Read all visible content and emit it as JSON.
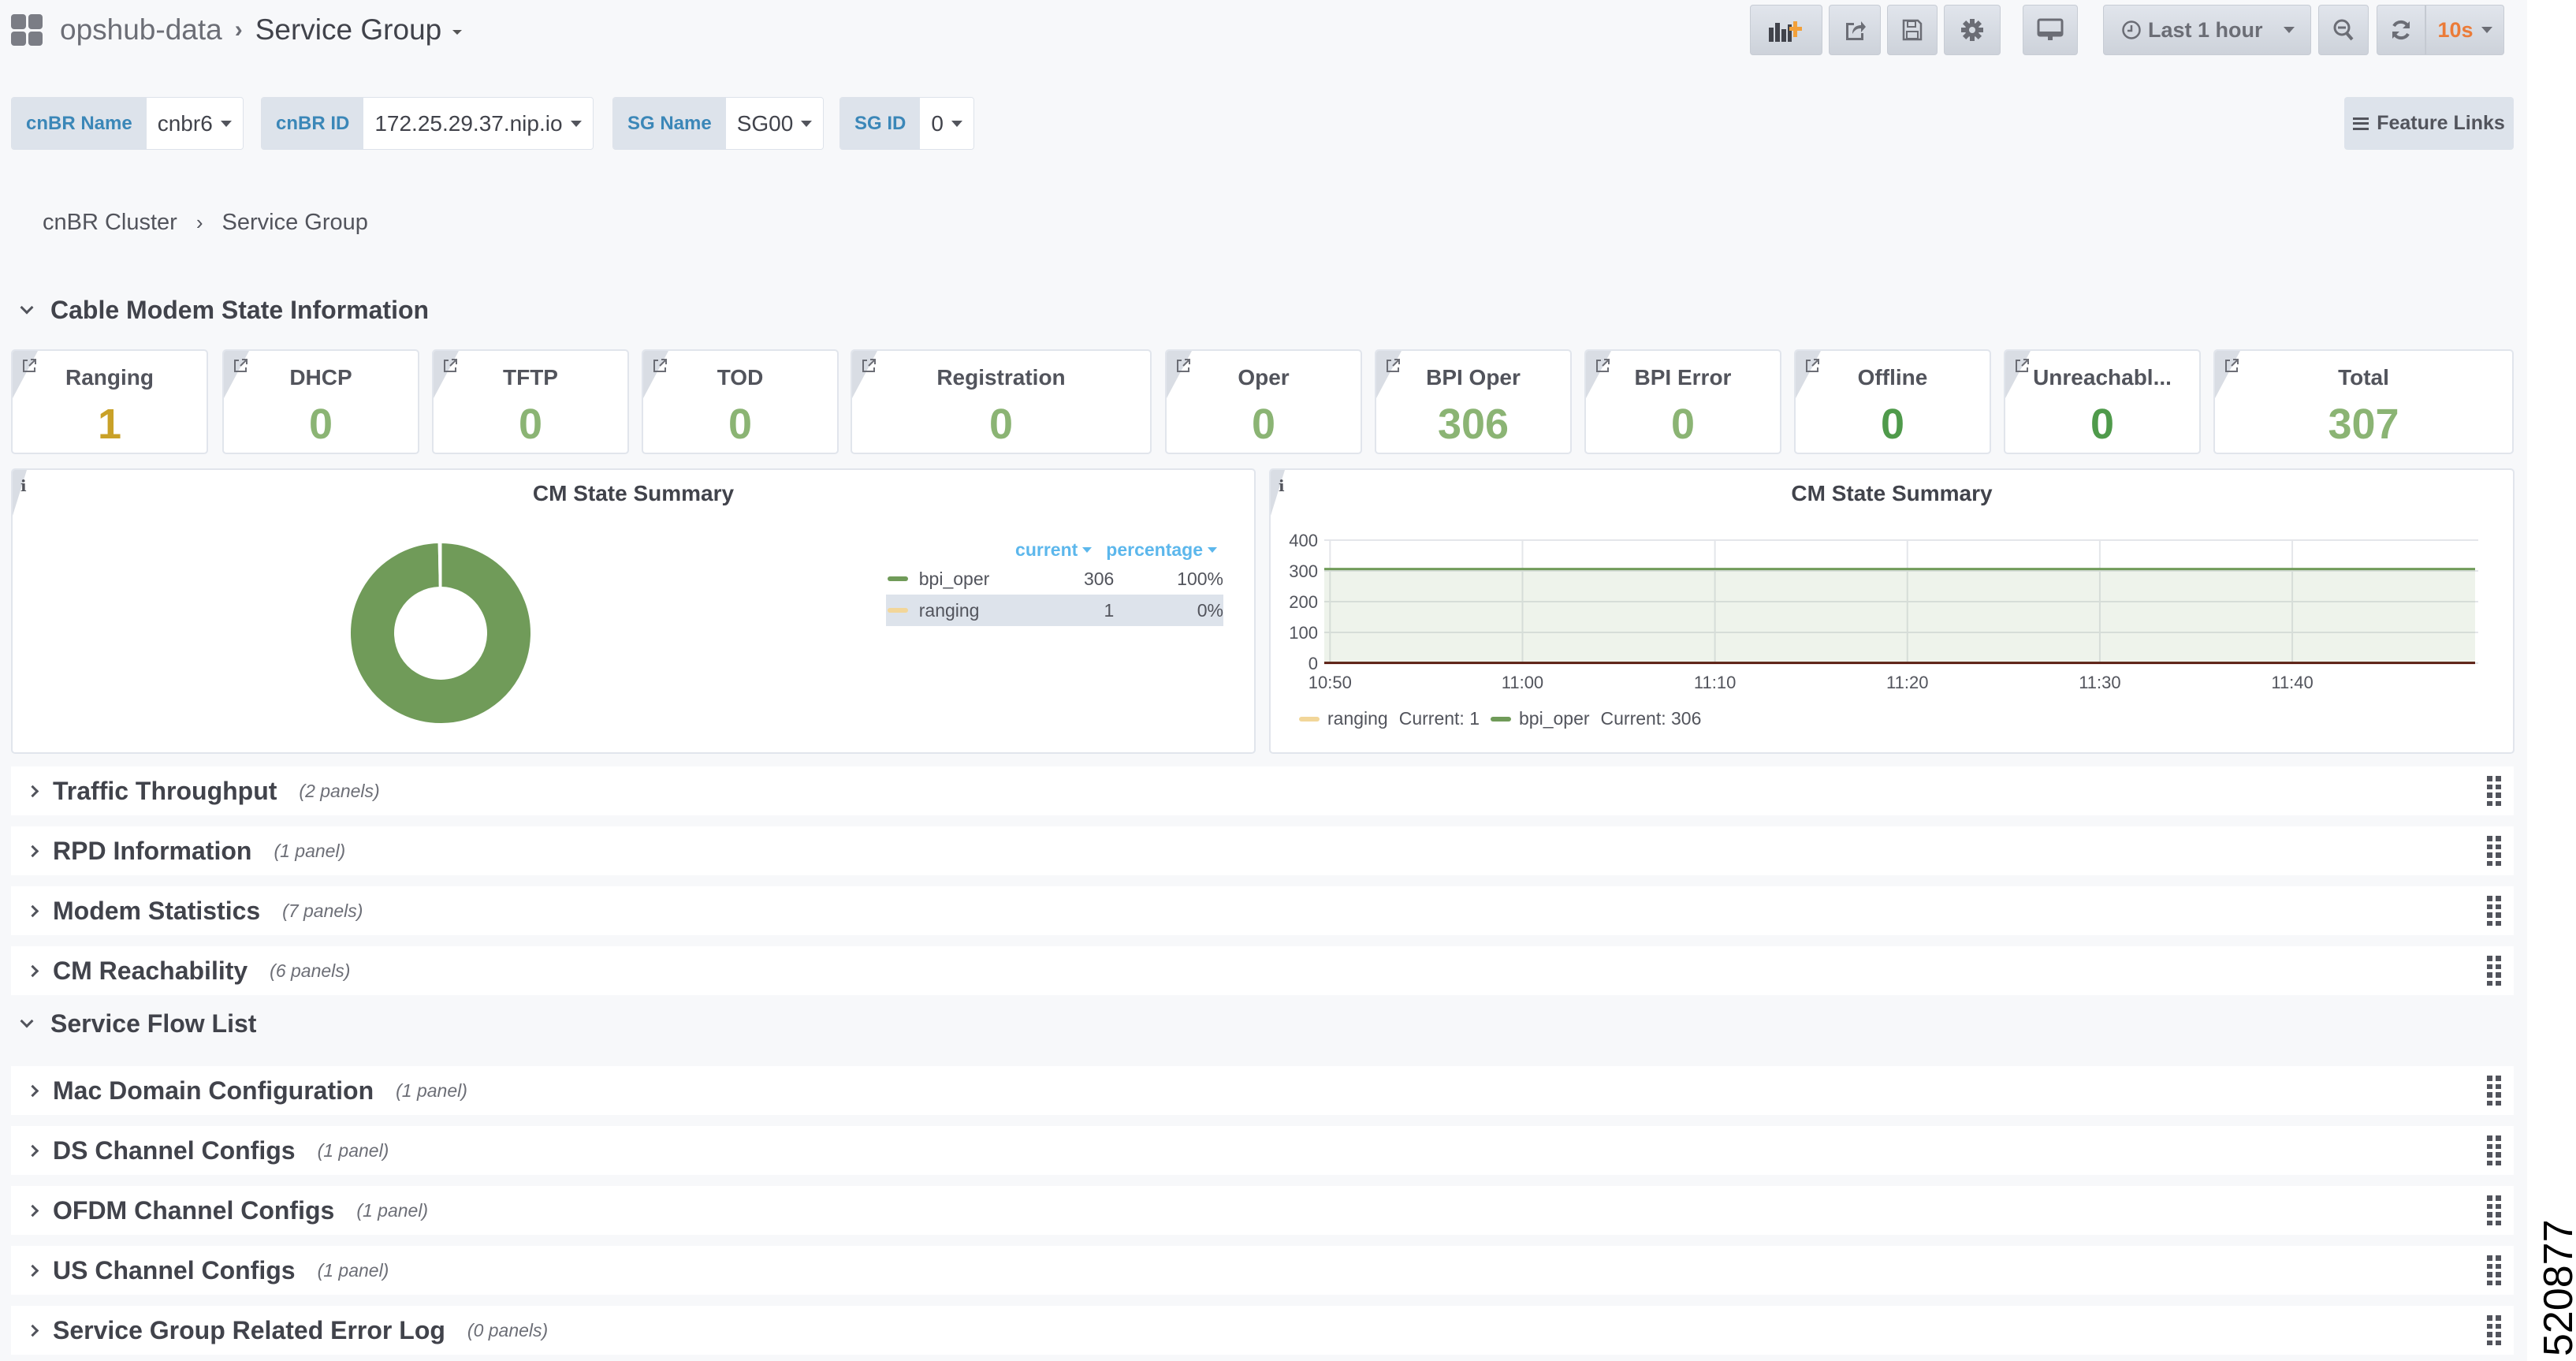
{
  "nav": {
    "breadcrumb_root": "opshub-data",
    "breadcrumb_separator": "›",
    "dashboard_title": "Service Group"
  },
  "toolbar": {
    "add_panel_icon": "bar-chart-plus-icon",
    "share_icon": "share-icon",
    "save_icon": "floppy-disk-icon",
    "settings_icon": "gear-icon",
    "tv_mode_icon": "monitor-icon",
    "time_range_label": "Last 1 hour",
    "zoom_out_icon": "zoom-out-icon",
    "refresh_icon": "refresh-icon",
    "refresh_interval": "10s",
    "accent_color": "#eb7b38"
  },
  "variables": [
    {
      "label": "cnBR Name",
      "value": "cnbr6"
    },
    {
      "label": "cnBR ID",
      "value": "172.25.29.37.nip.io"
    },
    {
      "label": "SG Name",
      "value": "SG00"
    },
    {
      "label": "SG ID",
      "value": "0"
    }
  ],
  "feature_links": {
    "label": "Feature Links",
    "icon": "hamburger-icon"
  },
  "page_breadcrumb": {
    "parent": "cnBR Cluster",
    "separator": "›",
    "current": "Service Group"
  },
  "cm_state_section": {
    "title": "Cable Modem State Information",
    "stats": [
      {
        "title": "Ranging",
        "value": "1",
        "color": "#c9a128"
      },
      {
        "title": "DHCP",
        "value": "0",
        "color": "#8bb474"
      },
      {
        "title": "TFTP",
        "value": "0",
        "color": "#8bb474"
      },
      {
        "title": "TOD",
        "value": "0",
        "color": "#8bb474"
      },
      {
        "title": "Registration",
        "value": "0",
        "color": "#8bb474"
      },
      {
        "title": "Oper",
        "value": "0",
        "color": "#8bb474"
      },
      {
        "title": "BPI Oper",
        "value": "306",
        "color": "#8bb474"
      },
      {
        "title": "BPI Error",
        "value": "0",
        "color": "#8bb474"
      },
      {
        "title": "Offline",
        "value": "0",
        "color": "#4f9a4b"
      },
      {
        "title": "Unreachabl...",
        "value": "0",
        "color": "#4f9a4b"
      },
      {
        "title": "Total",
        "value": "307",
        "color": "#8bb474"
      }
    ]
  },
  "chart_data": [
    {
      "type": "pie",
      "title": "CM State Summary",
      "donut": true,
      "legend_columns": [
        "current",
        "percentage"
      ],
      "series": [
        {
          "name": "bpi_oper",
          "value": 306,
          "current": "306",
          "percentage": "100%",
          "color": "#709b59"
        },
        {
          "name": "ranging",
          "value": 1,
          "current": "1",
          "percentage": "0%",
          "color": "#f2d699"
        }
      ],
      "legend_placement": "right"
    },
    {
      "type": "line",
      "title": "CM State Summary",
      "xlabel": "",
      "ylabel": "",
      "x_range": [
        "10:49.7",
        "11:49.5"
      ],
      "x_ticks": [
        "10:50",
        "11:00",
        "11:10",
        "11:20",
        "11:30",
        "11:40"
      ],
      "y_ticks": [
        0,
        100,
        200,
        300,
        400
      ],
      "ylim": [
        0,
        400
      ],
      "grid": true,
      "series": [
        {
          "name": "ranging",
          "color": "#f2d699",
          "line_color": "#58140c",
          "legend_text": "ranging",
          "current_label": "Current: 1",
          "x": [
            "10:50",
            "11:49"
          ],
          "values": [
            1,
            1
          ]
        },
        {
          "name": "bpi_oper",
          "color": "#709b59",
          "legend_text": "bpi_oper",
          "current_label": "Current: 306",
          "fill": true,
          "x": [
            "10:50",
            "11:49"
          ],
          "values": [
            306,
            306
          ]
        }
      ],
      "legend_placement": "bottom-left"
    }
  ],
  "collapsed_rows": [
    {
      "title": "Traffic Throughput",
      "count": "(2 panels)"
    },
    {
      "title": "RPD Information",
      "count": "(1 panel)"
    },
    {
      "title": "Modem Statistics",
      "count": "(7 panels)"
    },
    {
      "title": "CM Reachability",
      "count": "(6 panels)"
    }
  ],
  "open_row": {
    "title": "Service Flow List"
  },
  "collapsed_rows_2": [
    {
      "title": "Mac Domain Configuration",
      "count": "(1 panel)"
    },
    {
      "title": "DS Channel Configs",
      "count": "(1 panel)"
    },
    {
      "title": "OFDM Channel Configs",
      "count": "(1 panel)"
    },
    {
      "title": "US Channel Configs",
      "count": "(1 panel)"
    },
    {
      "title": "Service Group Related Error Log",
      "count": "(0 panels)"
    }
  ],
  "figure_id": "520877"
}
